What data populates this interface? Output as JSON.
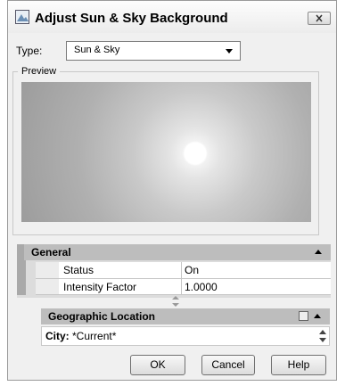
{
  "dialog": {
    "title": "Adjust Sun & Sky Background",
    "close_icon": "close-icon"
  },
  "type_field": {
    "label": "Type:",
    "value": "Sun & Sky"
  },
  "preview": {
    "label": "Preview"
  },
  "general": {
    "header": "General",
    "rows": [
      {
        "name": "Status",
        "value": "On"
      },
      {
        "name": "Intensity Factor",
        "value": "1.0000"
      }
    ]
  },
  "geo": {
    "header": "Geographic Location",
    "city_label": "City:",
    "city_value": "*Current*"
  },
  "buttons": {
    "ok": "OK",
    "cancel": "Cancel",
    "help": "Help"
  }
}
